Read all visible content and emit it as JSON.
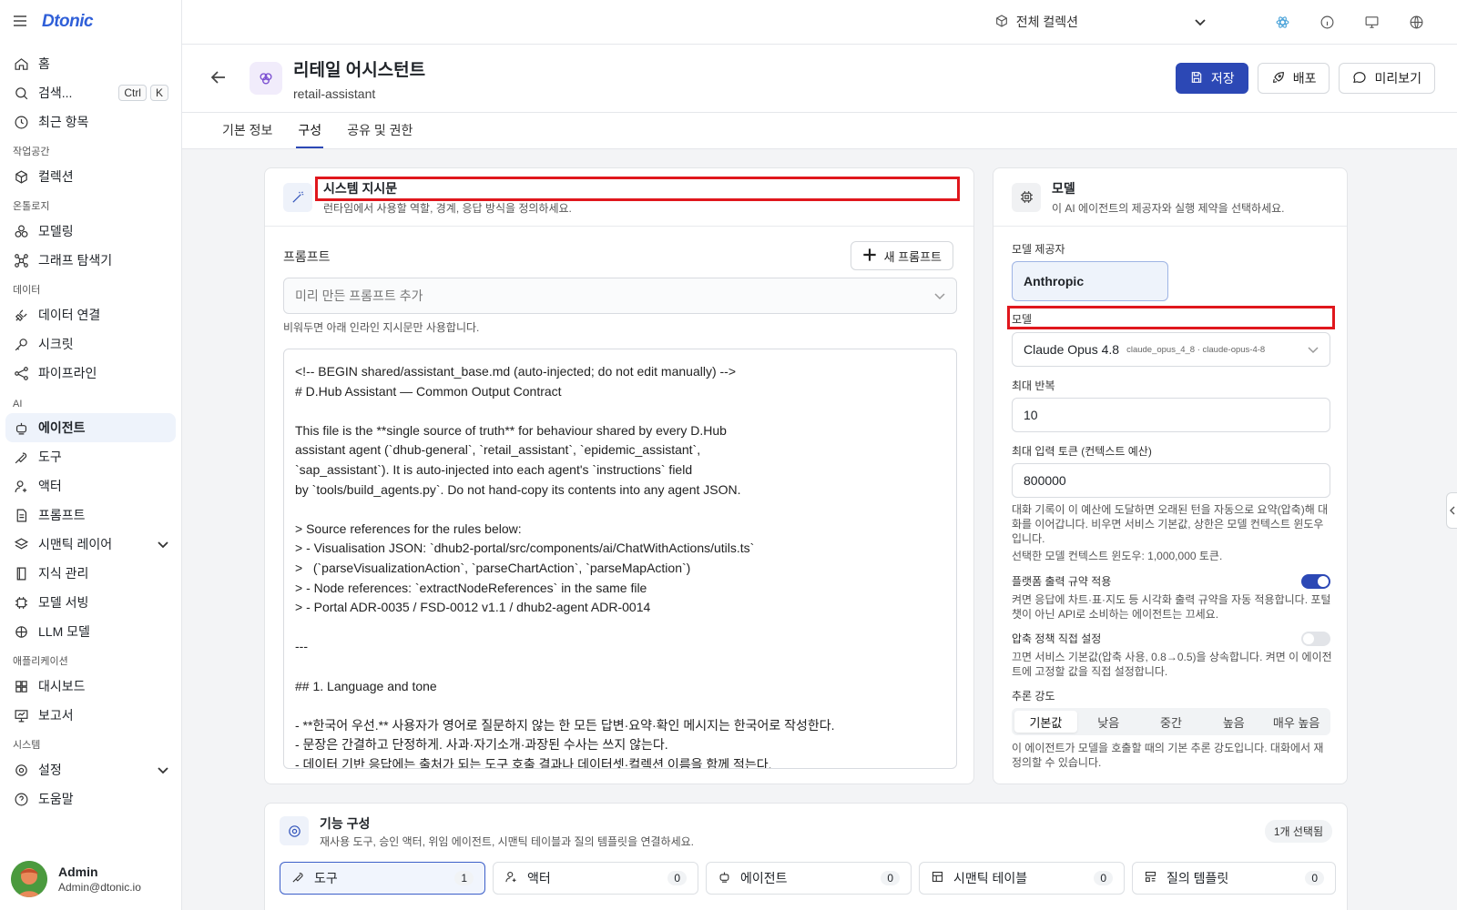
{
  "sidebar": {
    "logo": "Dtonic",
    "items_top": [
      {
        "label": "홈",
        "icon": "home-icon"
      },
      {
        "label": "검색...",
        "icon": "search-icon",
        "kbd": [
          "Ctrl",
          "K"
        ]
      },
      {
        "label": "최근 항목",
        "icon": "clock-icon"
      }
    ],
    "sections": {
      "workspace": "작업공간",
      "ontology": "온톨로지",
      "data": "데이터",
      "ai": "AI",
      "apps": "애플리케이션",
      "system": "시스템"
    },
    "workspace_items": [
      {
        "label": "컬렉션",
        "icon": "cube-icon"
      }
    ],
    "ontology_items": [
      {
        "label": "모델링",
        "icon": "model-icon"
      },
      {
        "label": "그래프 탐색기",
        "icon": "graph-icon"
      }
    ],
    "data_items": [
      {
        "label": "데이터 연결",
        "icon": "plug-icon"
      },
      {
        "label": "시크릿",
        "icon": "key-icon"
      },
      {
        "label": "파이프라인",
        "icon": "pipeline-icon"
      }
    ],
    "ai_items": [
      {
        "label": "에이전트",
        "icon": "bot-icon",
        "active": true
      },
      {
        "label": "도구",
        "icon": "wrench-icon"
      },
      {
        "label": "액터",
        "icon": "user-gear-icon"
      },
      {
        "label": "프롬프트",
        "icon": "document-icon"
      },
      {
        "label": "시맨틱 레이어",
        "icon": "layers-icon",
        "expandable": true
      },
      {
        "label": "지식 관리",
        "icon": "book-icon"
      },
      {
        "label": "모델 서빙",
        "icon": "chip-icon"
      },
      {
        "label": "LLM 모델",
        "icon": "brain-icon"
      }
    ],
    "app_items": [
      {
        "label": "대시보드",
        "icon": "dashboard-icon"
      },
      {
        "label": "보고서",
        "icon": "presentation-icon"
      }
    ],
    "system_items": [
      {
        "label": "설정",
        "icon": "gear-icon",
        "expandable": true
      },
      {
        "label": "도움말",
        "icon": "help-icon"
      }
    ],
    "user": {
      "name": "Admin",
      "email": "Admin@dtonic.io"
    }
  },
  "topbar": {
    "collection": "전체 컬렉션"
  },
  "header": {
    "title": "리테일 어시스턴트",
    "slug": "retail-assistant",
    "save_label": "저장",
    "deploy_label": "배포",
    "preview_label": "미리보기"
  },
  "tabs": [
    "기본 정보",
    "구성",
    "공유 및 권한"
  ],
  "system_prompt": {
    "title": "시스템 지시문",
    "subtitle": "런타임에서 사용할 역할, 경계, 응답 방식을 정의하세요.",
    "prompt_label": "프롬프트",
    "new_prompt_label": "새 프롬프트",
    "preset_placeholder": "미리 만든 프롬프트 추가",
    "preset_help": "비워두면 아래 인라인 지시문만 사용합니다.",
    "body": "<!-- BEGIN shared/assistant_base.md (auto-injected; do not edit manually) -->\n# D.Hub Assistant — Common Output Contract\n\nThis file is the **single source of truth** for behaviour shared by every D.Hub\nassistant agent (`dhub-general`, `retail_assistant`, `epidemic_assistant`,\n`sap_assistant`). It is auto-injected into each agent's `instructions` field\nby `tools/build_agents.py`. Do not hand-copy its contents into any agent JSON.\n\n> Source references for the rules below:\n> - Visualisation JSON: `dhub2-portal/src/components/ai/ChatWithActions/utils.ts`\n>   (`parseVisualizationAction`, `parseChartAction`, `parseMapAction`)\n> - Node references: `extractNodeReferences` in the same file\n> - Portal ADR-0035 / FSD-0012 v1.1 / dhub2-agent ADR-0014\n\n---\n\n## 1. Language and tone\n\n- **한국어 우선.** 사용자가 영어로 질문하지 않는 한 모든 답변·요약·확인 메시지는 한국어로 작성한다.\n- 문장은 간결하고 단정하게. 사과·자기소개·과장된 수사는 쓰지 않는다.\n- 데이터 기반 응답에는 출처가 되는 도구 호출 결과나 데이터셋·컬렉션 이름을 함께 적는다."
  },
  "model": {
    "title": "모델",
    "subtitle": "이 AI 에이전트의 제공자와 실행 제약을 선택하세요.",
    "provider_label": "모델 제공자",
    "provider_value": "Anthropic",
    "model_label": "모델",
    "model_value": "Claude Opus 4.8",
    "model_ids": "claude_opus_4_8 · claude-opus-4-8",
    "max_iter_label": "최대 반복",
    "max_iter_value": "10",
    "max_tokens_label": "최대 입력 토큰 (컨텍스트 예산)",
    "max_tokens_value": "800000",
    "max_tokens_help": "대화 기록이 이 예산에 도달하면 오래된 턴을 자동으로 요약(압축)해 대화를 이어갑니다. 비우면 서비스 기본값, 상한은 모델 컨텍스트 윈도우입니다.",
    "context_window_note": "선택한 모델 컨텍스트 윈도우: 1,000,000 토큰.",
    "output_contract_label": "플랫폼 출력 규약 적용",
    "output_contract_help": "켜면 응답에 차트·표·지도 등 시각화 출력 규약을 자동 적용합니다. 포털 챗이 아닌 API로 소비하는 에이전트는 끄세요.",
    "output_contract_on": true,
    "compression_label": "압축 정책 직접 설정",
    "compression_help": "끄면 서비스 기본값(압축 사용, 0.8→0.5)을 상속합니다. 켜면 이 에이전트에 고정할 값을 직접 설정합니다.",
    "compression_on": false,
    "reasoning_label": "추론 강도",
    "reasoning_options": [
      "기본값",
      "낮음",
      "중간",
      "높음",
      "매우 높음"
    ],
    "reasoning_selected": "기본값",
    "reasoning_help": "이 에이전트가 모델을 호출할 때의 기본 추론 강도입니다. 대화에서 재정의할 수 있습니다."
  },
  "features": {
    "title": "기능 구성",
    "subtitle": "재사용 도구, 승인 액터, 위임 에이전트, 시맨틱 테이블과 질의 템플릿을 연결하세요.",
    "selected_badge": "1개 선택됨",
    "tabs": [
      {
        "label": "도구",
        "count": "1",
        "icon": "wrench-icon"
      },
      {
        "label": "액터",
        "count": "0",
        "icon": "user-gear-icon"
      },
      {
        "label": "에이전트",
        "count": "0",
        "icon": "bot-icon"
      },
      {
        "label": "시맨틱 테이블",
        "count": "0",
        "icon": "table-icon"
      },
      {
        "label": "질의 템플릿",
        "count": "0",
        "icon": "template-icon"
      }
    ]
  }
}
